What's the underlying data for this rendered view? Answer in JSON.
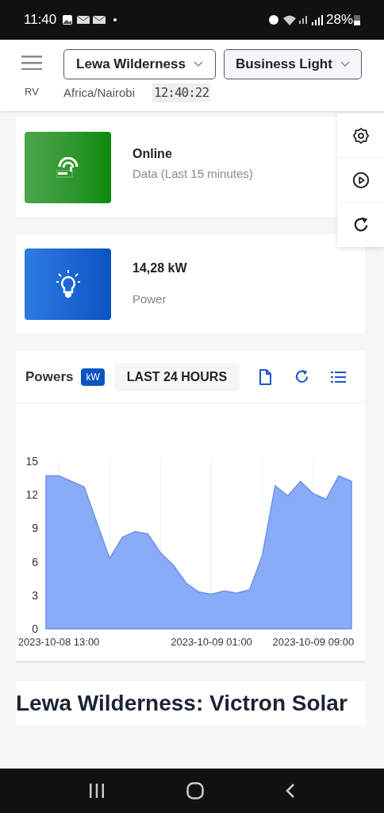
{
  "status_bar": {
    "time": "11:40",
    "battery": "28%"
  },
  "header": {
    "user": "RV",
    "site_select": "Lewa Wilderness",
    "profile_select": "Business Light",
    "timezone": "Africa/Nairobi",
    "clock": "12:40:22"
  },
  "cards": [
    {
      "kind": "status",
      "value": "Online",
      "label": "Data (Last 15 minutes)"
    },
    {
      "kind": "power",
      "value": "14,28 kW",
      "label": "Power"
    }
  ],
  "chart_panel": {
    "title": "Powers",
    "unit": "kW",
    "range_button": "LAST 24 HOURS",
    "chart_data": {
      "type": "area",
      "categories": [
        null,
        "2023-10-08 13:00",
        null,
        null,
        null,
        null,
        null,
        null,
        null,
        null,
        null,
        null,
        null,
        "2023-10-09 01:00",
        null,
        null,
        null,
        null,
        null,
        null,
        null,
        "2023-10-09 09:00",
        null,
        null,
        null
      ],
      "values": [
        13.7,
        13.7,
        13.2,
        12.7,
        9.5,
        6.3,
        8.2,
        8.7,
        8.5,
        6.8,
        5.7,
        4.1,
        3.3,
        3.1,
        3.4,
        3.2,
        3.5,
        6.6,
        12.8,
        11.9,
        13.2,
        12.1,
        11.6,
        13.7,
        13.2
      ],
      "ylim": [
        0,
        15
      ],
      "yticks": [
        0,
        3,
        6,
        9,
        12,
        15
      ],
      "grid": true
    }
  },
  "page_title": "Lewa Wilderness: Victron Solar"
}
